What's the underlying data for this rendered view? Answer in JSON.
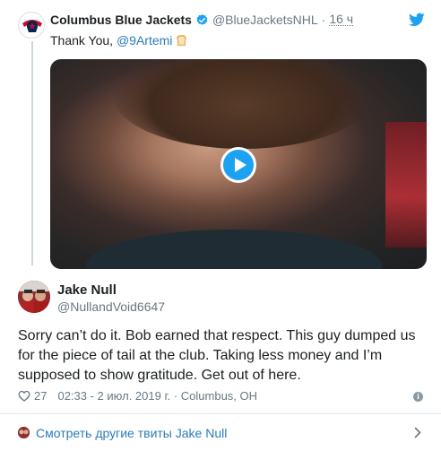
{
  "parent_tweet": {
    "display_name": "Columbus Blue Jackets",
    "handle": "@BlueJacketsNHL",
    "separator": "·",
    "time": "16 ч",
    "text_prefix": "Thank You, ",
    "mention": "@9Artemi",
    "emoji": "bread-emoji"
  },
  "tweet": {
    "display_name": "Jake Null",
    "handle": "@NullandVoid6647",
    "text": "Sorry can’t do it. Bob earned that respect. This guy dumped us for the piece of tail at the club. Taking less money and I’m supposed to show gratitude. Get out of here.",
    "likes": "27",
    "timestamp": "02:33 - 2 июл. 2019 г. · Columbus, OH"
  },
  "footer": {
    "more_tweets_label": "Смотреть другие твиты Jake Null"
  },
  "colors": {
    "link": "#2b7bb9",
    "twitter_blue": "#1da1f2",
    "muted": "#697882"
  }
}
